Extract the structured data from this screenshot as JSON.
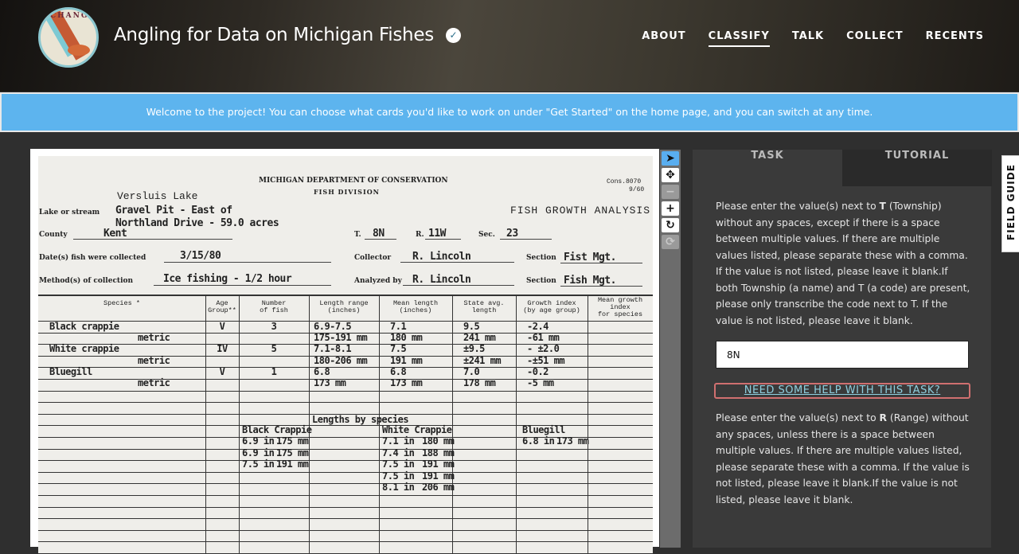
{
  "header": {
    "logo_text": "CHANGES",
    "title": "Angling for Data on Michigan Fishes",
    "verified_icon": "check-circle-icon",
    "nav": [
      {
        "label": "ABOUT",
        "active": false
      },
      {
        "label": "CLASSIFY",
        "active": true
      },
      {
        "label": "TALK",
        "active": false
      },
      {
        "label": "COLLECT",
        "active": false
      },
      {
        "label": "RECENTS",
        "active": false
      }
    ]
  },
  "banner": {
    "text": "Welcome to the project! You can choose what cards you'd like to work on under \"Get Started\" on the home page, and you can switch at any time."
  },
  "document": {
    "dept": "MICHIGAN DEPARTMENT OF CONSERVATION",
    "division": "FISH DIVISION",
    "form_no": "Cons.8070",
    "form_date": "9/60",
    "form_title": "FISH GROWTH ANALYSIS",
    "lake_name": "Versluis Lake",
    "lake_label": "Lake or stream",
    "lake_value_1": "Gravel Pit - East of",
    "lake_value_2": "Northland Drive - 59.0 acres",
    "county_label": "County",
    "county_value": "Kent",
    "t_label": "T.",
    "t_value": "8N",
    "r_label": "R.",
    "r_value": "11W",
    "sec_label": "Sec.",
    "sec_value": "23",
    "date_label": "Date(s) fish were collected",
    "date_value": "3/15/80",
    "collector_label": "Collector",
    "collector_value": "R. Lincoln",
    "section_label": "Section",
    "section_value_1": "Fist Mgt.",
    "method_label": "Method(s) of collection",
    "method_value": "Ice fishing - 1/2 hour",
    "analyzed_label": "Analyzed by",
    "analyzed_value": "R. Lincoln",
    "section_value_2": "Fish Mgt.",
    "columns": [
      "Species *",
      "Age\nGroup**",
      "Number\nof fish",
      "Length range\n(inches)",
      "Mean length\n(inches)",
      "State avg.\nlength",
      "Growth index\n(by age group)",
      "Mean growth\nindex\nfor species"
    ],
    "rows": [
      [
        "Black crappie",
        "V",
        "3",
        "6.9-7.5",
        "7.1",
        "9.5",
        "-2.4",
        ""
      ],
      [
        "metric",
        "",
        "",
        "175-191 mm",
        "180 mm",
        "241 mm",
        "-61 mm",
        ""
      ],
      [
        "White crappie",
        "IV",
        "5",
        "7.1-8.1",
        "7.5",
        "±9.5",
        "- ±2.0",
        ""
      ],
      [
        "metric",
        "",
        "",
        "180-206 mm",
        "191 mm",
        "±241 mm",
        "-±51 mm",
        ""
      ],
      [
        "Bluegill",
        "V",
        "1",
        "6.8",
        "6.8",
        "7.0",
        "-0.2",
        ""
      ],
      [
        "metric",
        "",
        "",
        "173 mm",
        "173 mm",
        "178 mm",
        "-5 mm",
        ""
      ]
    ],
    "lengths_title": "Lengths by species",
    "lengths": [
      {
        "species": "Black Crappie",
        "entries": [
          [
            "6.9 in",
            "175 mm"
          ],
          [
            "6.9 in",
            "175 mm"
          ],
          [
            "7.5 in",
            "191 mm"
          ]
        ]
      },
      {
        "species": "White Crappie",
        "entries": [
          [
            "7.1 in",
            "180 mm"
          ],
          [
            "7.4 in",
            "188 mm"
          ],
          [
            "7.5 in",
            "191 mm"
          ],
          [
            "7.5 in",
            "191 mm"
          ],
          [
            "8.1 in",
            "206 mm"
          ]
        ]
      },
      {
        "species": "Bluegill",
        "entries": [
          [
            "6.8 in",
            "173 mm"
          ]
        ]
      }
    ]
  },
  "toolbar": {
    "tools": [
      {
        "icon": "pointer-icon",
        "glyph": "➤",
        "state": "selected"
      },
      {
        "icon": "move-icon",
        "glyph": "✥",
        "state": "normal"
      },
      {
        "icon": "zoom-out-icon",
        "glyph": "−",
        "state": "disabled"
      },
      {
        "icon": "zoom-in-icon",
        "glyph": "+",
        "state": "normal"
      },
      {
        "icon": "rotate-icon",
        "glyph": "↻",
        "state": "normal"
      },
      {
        "icon": "reset-icon",
        "glyph": "⟳",
        "state": "disabled"
      }
    ]
  },
  "task": {
    "tabs": {
      "task": "TASK",
      "tutorial": "TUTORIAL"
    },
    "q1_pre": "Please enter the value(s) next to ",
    "q1_bold": "T",
    "q1_post": " (Township) without any spaces, except if there is a space between multiple values. If there are multiple values listed, please separate these with a comma. If the value is not listed, please leave it blank.If both Township (a name) and T (a code) are present, please only transcribe the code next to T. If the value is not listed, please leave it blank.",
    "answer": "8N",
    "help": "NEED SOME HELP WITH THIS TASK?",
    "q2_pre": "Please enter the value(s) next to ",
    "q2_bold": "R",
    "q2_post": " (Range) without any spaces, unless there is a space between multiple values. If there are multiple values listed, please separate these with a comma. If the value is not listed, please leave it blank.If the value is not listed, please leave it blank."
  },
  "field_guide": {
    "label": "FIELD GUIDE"
  }
}
